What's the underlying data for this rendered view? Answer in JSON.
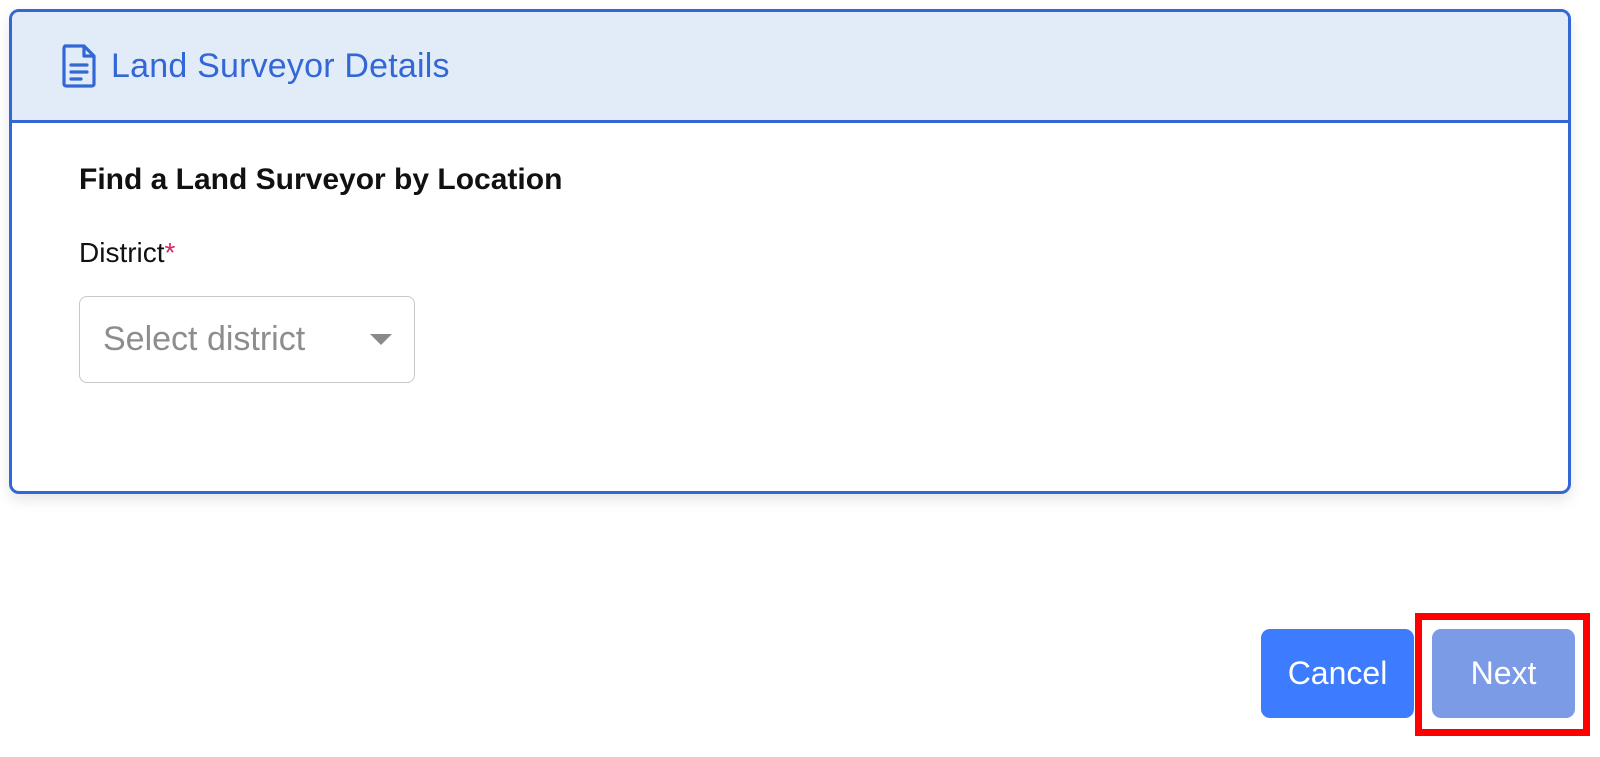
{
  "card": {
    "title": "Land Surveyor Details",
    "icon": "document-icon",
    "section_title": "Find a Land Surveyor by Location",
    "district_label": "District",
    "required_marker": "*",
    "district_select": {
      "placeholder": "Select district",
      "value": ""
    }
  },
  "actions": {
    "cancel_label": "Cancel",
    "next_label": "Next"
  },
  "colors": {
    "accent": "#3367d6",
    "header_bg": "#e1ecf8",
    "cancel_bg": "#3d7bff",
    "next_bg": "#7c9be6",
    "required": "#e0245e",
    "highlight": "#ff0000"
  }
}
